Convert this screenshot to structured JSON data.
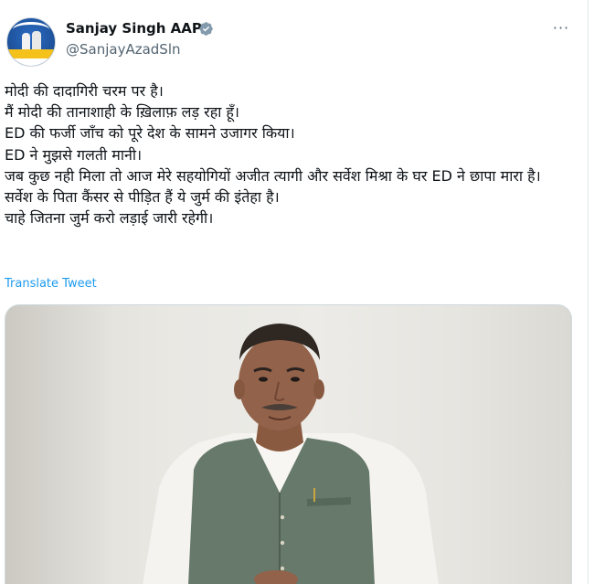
{
  "author": {
    "display_name": "Sanjay Singh AAP",
    "handle": "@SanjayAzadSln",
    "avatar_icon": "profile-photo-avatar",
    "verified_icon": "verified-badge-icon",
    "verified_color": "#829aab"
  },
  "more_icon": "more-options-icon",
  "more_label": "···",
  "tweet_lines": [
    "मोदी की दादागिरी चरम पर है।",
    "मैं मोदी की तानाशाही के ख़िलाफ़ लड़ रहा हूँ।",
    "ED की फर्जी जाँच को पूरे देश के सामने उजागर किया।",
    "ED ने मुझसे गलती मानी।",
    "जब कुछ नही मिला तो आज मेरे सहयोगियों अजीत त्यागी और सर्वेश मिश्रा के घर ED ने छापा मारा है।",
    "सर्वेश के पिता कैंसर से पीड़ित हैं ये जुर्म की इंतेहा है।",
    "चाहे जितना जुर्म करो लड़ाई जारी रहेगी।"
  ],
  "translate_label": "Translate Tweet",
  "colors": {
    "link": "#1d9bf0",
    "secondary_text": "#536471",
    "primary_text": "#0f1419"
  },
  "media": {
    "type": "video-thumbnail",
    "subject": "man in green vest over white kurta"
  }
}
